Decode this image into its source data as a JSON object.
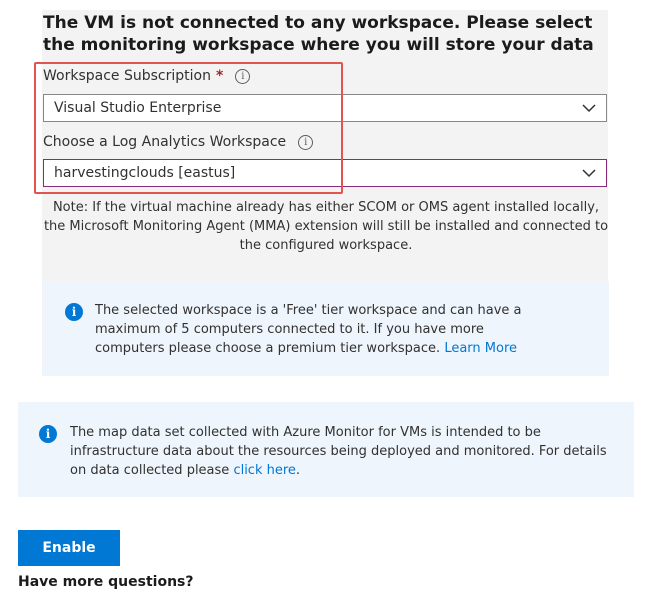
{
  "workspace_section": {
    "heading": "The VM is not connected to any workspace. Please select the monitoring workspace where you will store your data",
    "subscription": {
      "label": "Workspace Subscription",
      "required_mark": "*",
      "value": "Visual Studio Enterprise"
    },
    "log_analytics": {
      "label": "Choose a Log Analytics Workspace",
      "value": "harvestingclouds [eastus]"
    },
    "note": "Note: If the virtual machine already has either SCOM or OMS agent installed locally, the Microsoft Monitoring Agent (MMA) extension will still be installed and connected to the configured workspace.",
    "free_tier_info": {
      "text": "The selected workspace is a 'Free' tier workspace and can have a maximum of 5 computers connected to it. If you have more computers please choose a premium tier workspace.",
      "link": "Learn More"
    }
  },
  "map_info": {
    "text": "The map data set collected with Azure Monitor for VMs is intended to be infrastructure data about the resources being deployed and monitored. For details on data collected please",
    "link": "click here",
    "suffix": "."
  },
  "actions": {
    "enable_label": "Enable"
  },
  "footer": {
    "questions": "Have more questions?"
  },
  "icons": {
    "info": "info-icon",
    "tooltip": "info-circle-icon",
    "chevron": "chevron-down-icon"
  },
  "colors": {
    "accent": "#0078d4",
    "focus_border": "#8a2a7c",
    "highlight": "#e2544f",
    "panel_bg": "#f3f3f3",
    "info_bg": "#eff5fc",
    "required": "#a4262c"
  }
}
